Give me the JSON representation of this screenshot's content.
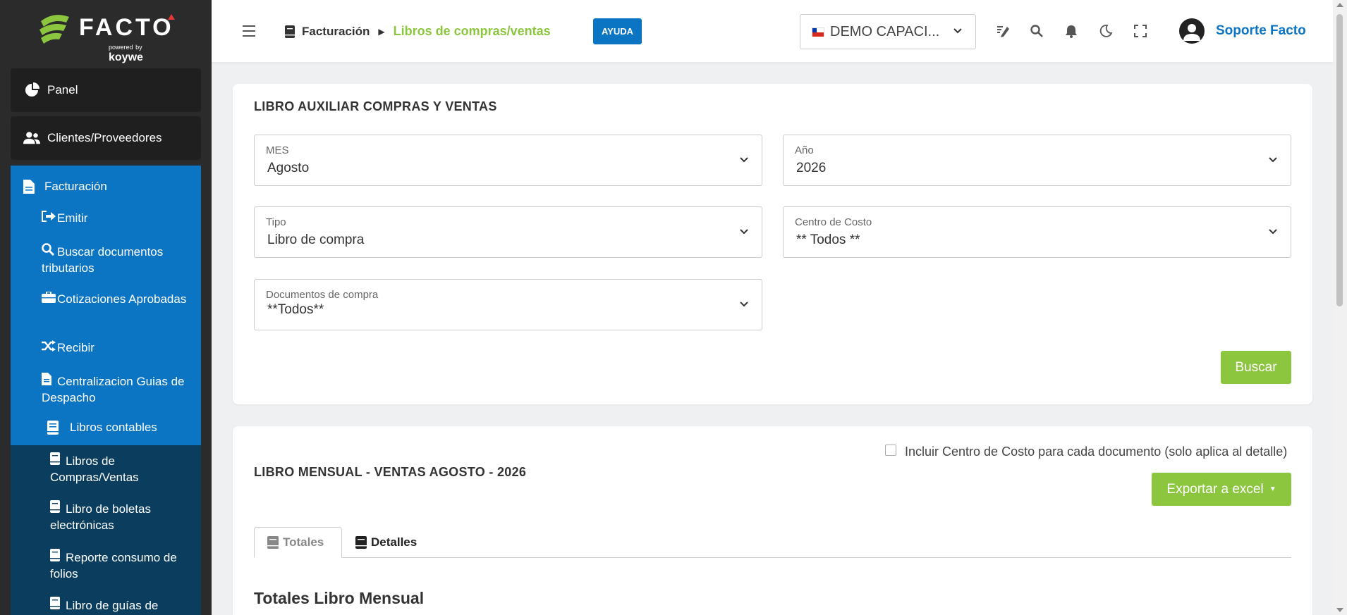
{
  "brand": {
    "name": "FACTO",
    "powered": "powered",
    "by": "by",
    "vendor": "koywe"
  },
  "sidebar": {
    "panel": "Panel",
    "clientes": "Clientes/Proveedores",
    "facturacion": "Facturación",
    "items": [
      {
        "label": "Emitir",
        "icon": "sign-out-icon"
      },
      {
        "label": "Buscar documentos tributarios",
        "icon": "search-icon"
      },
      {
        "label": "Cotizaciones Aprobadas",
        "icon": "briefcase-icon"
      },
      {
        "label": "Recibir",
        "icon": "shuffle-icon"
      },
      {
        "label": "Centralizacion Guias de Despacho",
        "icon": "file-icon"
      }
    ],
    "libros_contables": "Libros contables",
    "libros_items": [
      {
        "label": "Libros de Compras/Ventas",
        "icon": "book-icon"
      },
      {
        "label": "Libro de boletas electrónicas",
        "icon": "book-icon"
      },
      {
        "label": "Reporte consumo de folios",
        "icon": "book-icon"
      },
      {
        "label": "Libro de guías de",
        "icon": "book-icon"
      }
    ]
  },
  "topbar": {
    "crumb_parent": "Facturación",
    "crumb_current": "Libros de compras/ventas",
    "help": "AYUDA",
    "company": "DEMO CAPACI...",
    "user": "Soporte Facto"
  },
  "filters": {
    "title": "LIBRO AUXILIAR COMPRAS Y VENTAS",
    "mes_label": "MES",
    "mes_value": "Agosto",
    "anio_label": "Año",
    "anio_value": "2026",
    "tipo_label": "Tipo",
    "tipo_value": "Libro de compra",
    "cc_label": "Centro de Costo",
    "cc_value": "** Todos **",
    "docs_label": "Documentos de compra",
    "docs_value": "**Todos**",
    "search": "Buscar"
  },
  "monthly": {
    "title": "LIBRO MENSUAL - VENTAS AGOSTO - 2026",
    "include_cc": "Incluir Centro de Costo para cada documento (solo aplica al detalle)",
    "export": "Exportar a excel",
    "tab_totales": "Totales",
    "tab_detalles": "Detalles",
    "section_title": "Totales Libro Mensual"
  },
  "colors": {
    "accent_green": "#8cc63f",
    "accent_blue": "#0b75c4",
    "sidebar_dark": "#2b2b2b",
    "sidebar_navy": "#0a3d5e"
  }
}
